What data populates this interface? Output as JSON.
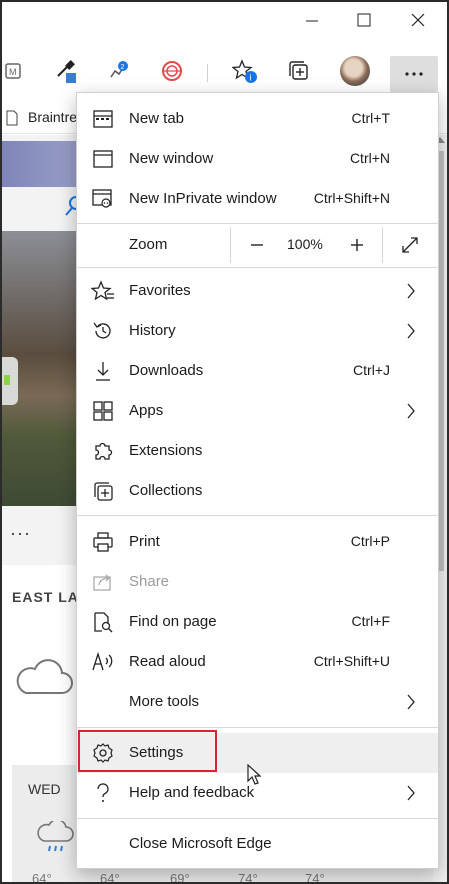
{
  "favorites_bar": {
    "item_label": "Braintre"
  },
  "page": {
    "location_label": "EAST LA",
    "forecast": {
      "day": "WED",
      "temps": [
        "64°",
        "64°",
        "69°",
        "74°",
        "74°"
      ]
    },
    "more_label": "···"
  },
  "zoom": {
    "label": "Zoom",
    "value": "100%",
    "minus": "—",
    "plus": "+"
  },
  "menu": {
    "new_tab": {
      "label": "New tab",
      "shortcut": "Ctrl+T"
    },
    "new_window": {
      "label": "New window",
      "shortcut": "Ctrl+N"
    },
    "new_inprivate": {
      "label": "New InPrivate window",
      "shortcut": "Ctrl+Shift+N"
    },
    "favorites": {
      "label": "Favorites"
    },
    "history": {
      "label": "History"
    },
    "downloads": {
      "label": "Downloads",
      "shortcut": "Ctrl+J"
    },
    "apps": {
      "label": "Apps"
    },
    "extensions": {
      "label": "Extensions"
    },
    "collections": {
      "label": "Collections"
    },
    "print": {
      "label": "Print",
      "shortcut": "Ctrl+P"
    },
    "share": {
      "label": "Share"
    },
    "find": {
      "label": "Find on page",
      "shortcut": "Ctrl+F"
    },
    "read_aloud": {
      "label": "Read aloud",
      "shortcut": "Ctrl+Shift+U"
    },
    "more_tools": {
      "label": "More tools"
    },
    "settings": {
      "label": "Settings"
    },
    "help": {
      "label": "Help and feedback"
    },
    "close": {
      "label": "Close Microsoft Edge"
    }
  },
  "colors": {
    "highlight_box": "#d9232f",
    "menu_bg": "#ffffff",
    "hover_bg": "#efefef",
    "profile_badge": "#1a73e8"
  }
}
